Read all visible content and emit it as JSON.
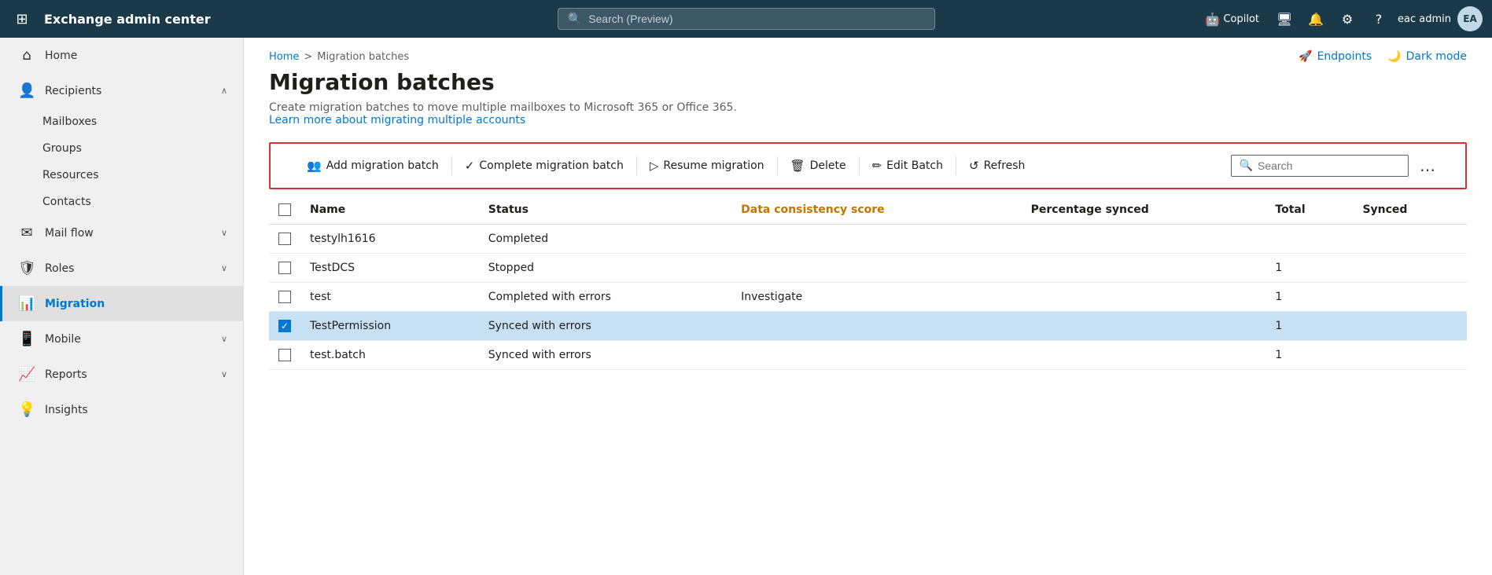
{
  "topNav": {
    "waffle_icon": "⊞",
    "title": "Exchange admin center",
    "search_placeholder": "Search (Preview)",
    "copilot_label": "Copilot",
    "user_label": "eac admin",
    "user_initials": "EA"
  },
  "sidebar": {
    "collapse_icon": "☰",
    "items": [
      {
        "id": "home",
        "label": "Home",
        "icon": "⌂",
        "expandable": false
      },
      {
        "id": "recipients",
        "label": "Recipients",
        "icon": "👤",
        "expandable": true,
        "expanded": true
      },
      {
        "id": "mailboxes",
        "label": "Mailboxes",
        "icon": "",
        "sub": true
      },
      {
        "id": "groups",
        "label": "Groups",
        "icon": "",
        "sub": true
      },
      {
        "id": "resources",
        "label": "Resources",
        "icon": "",
        "sub": true
      },
      {
        "id": "contacts",
        "label": "Contacts",
        "icon": "",
        "sub": true
      },
      {
        "id": "mailflow",
        "label": "Mail flow",
        "icon": "✉",
        "expandable": true
      },
      {
        "id": "roles",
        "label": "Roles",
        "icon": "🛡",
        "expandable": true
      },
      {
        "id": "migration",
        "label": "Migration",
        "icon": "📊",
        "expandable": false,
        "active": true
      },
      {
        "id": "mobile",
        "label": "Mobile",
        "icon": "📱",
        "expandable": true
      },
      {
        "id": "reports",
        "label": "Reports",
        "icon": "📈",
        "expandable": true
      },
      {
        "id": "insights",
        "label": "Insights",
        "icon": "💡",
        "expandable": false
      }
    ]
  },
  "breadcrumb": {
    "home_label": "Home",
    "separator": ">",
    "current": "Migration batches"
  },
  "topActions": [
    {
      "id": "endpoints",
      "icon": "🚀",
      "label": "Endpoints"
    },
    {
      "id": "darkmode",
      "icon": "🌙",
      "label": "Dark mode"
    }
  ],
  "page": {
    "title": "Migration batches",
    "description": "Create migration batches to move multiple mailboxes to Microsoft 365 or Office 365.",
    "learn_more": "Learn more about migrating multiple accounts"
  },
  "toolbar": {
    "buttons": [
      {
        "id": "add-migration-batch",
        "icon": "👥",
        "label": "Add migration batch"
      },
      {
        "id": "complete-migration-batch",
        "icon": "✓",
        "label": "Complete migration batch"
      },
      {
        "id": "resume-migration",
        "icon": "▷",
        "label": "Resume migration"
      },
      {
        "id": "delete",
        "icon": "🗑",
        "label": "Delete"
      },
      {
        "id": "edit-batch",
        "icon": "✏",
        "label": "Edit Batch"
      },
      {
        "id": "refresh",
        "icon": "↺",
        "label": "Refresh"
      }
    ],
    "search_placeholder": "Search",
    "more_icon": "..."
  },
  "table": {
    "columns": [
      {
        "id": "name",
        "label": "Name",
        "color": "normal"
      },
      {
        "id": "status",
        "label": "Status",
        "color": "normal"
      },
      {
        "id": "consistency",
        "label": "Data consistency score",
        "color": "orange"
      },
      {
        "id": "percentage",
        "label": "Percentage synced",
        "color": "normal"
      },
      {
        "id": "total",
        "label": "Total",
        "color": "normal"
      },
      {
        "id": "synced",
        "label": "Synced",
        "color": "normal"
      }
    ],
    "rows": [
      {
        "id": "row1",
        "name": "testylh1616",
        "status": "Completed",
        "consistency": "",
        "percentage": "",
        "total": "",
        "synced": "",
        "selected": false
      },
      {
        "id": "row2",
        "name": "TestDCS",
        "status": "Stopped",
        "consistency": "",
        "percentage": "",
        "total": "1",
        "synced": "",
        "selected": false
      },
      {
        "id": "row3",
        "name": "test",
        "status": "Completed with errors",
        "consistency": "Investigate",
        "percentage": "",
        "total": "1",
        "synced": "",
        "selected": false
      },
      {
        "id": "row4",
        "name": "TestPermission",
        "status": "Synced with errors",
        "consistency": "",
        "percentage": "",
        "total": "1",
        "synced": "",
        "selected": true
      },
      {
        "id": "row5",
        "name": "test.batch",
        "status": "Synced with errors",
        "consistency": "",
        "percentage": "",
        "total": "1",
        "synced": "",
        "selected": false
      }
    ]
  }
}
